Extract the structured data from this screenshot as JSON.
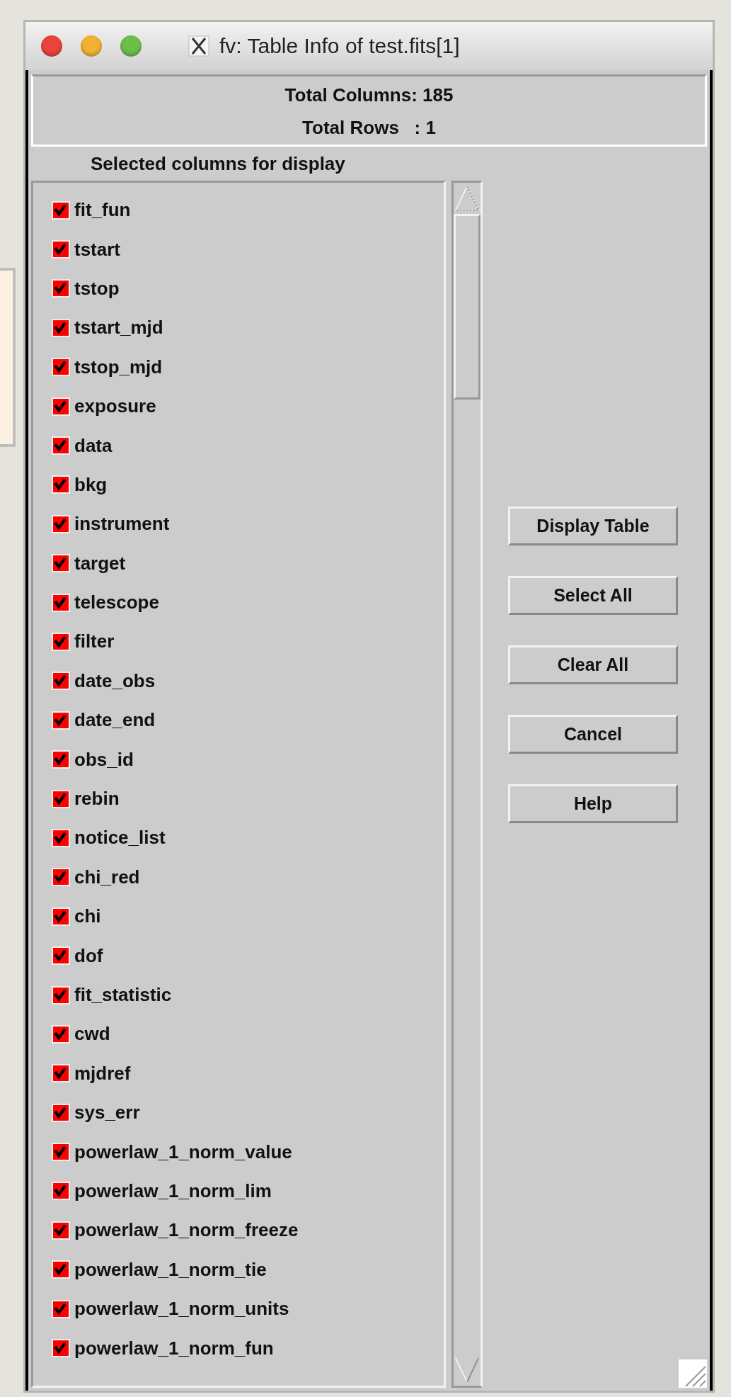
{
  "window": {
    "title": "fv: Table Info of test.fits[1]"
  },
  "info": [
    "Total Columns: 185",
    "Total Rows   : 1"
  ],
  "caption": "Selected columns for display",
  "columns": [
    {
      "label": "fit_fun",
      "checked": true
    },
    {
      "label": "tstart",
      "checked": true
    },
    {
      "label": "tstop",
      "checked": true
    },
    {
      "label": "tstart_mjd",
      "checked": true
    },
    {
      "label": "tstop_mjd",
      "checked": true
    },
    {
      "label": "exposure",
      "checked": true
    },
    {
      "label": "data",
      "checked": true
    },
    {
      "label": "bkg",
      "checked": true
    },
    {
      "label": "instrument",
      "checked": true
    },
    {
      "label": "target",
      "checked": true
    },
    {
      "label": "telescope",
      "checked": true
    },
    {
      "label": "filter",
      "checked": true
    },
    {
      "label": "date_obs",
      "checked": true
    },
    {
      "label": "date_end",
      "checked": true
    },
    {
      "label": "obs_id",
      "checked": true
    },
    {
      "label": "rebin",
      "checked": true
    },
    {
      "label": "notice_list",
      "checked": true
    },
    {
      "label": "chi_red",
      "checked": true
    },
    {
      "label": "chi",
      "checked": true
    },
    {
      "label": "dof",
      "checked": true
    },
    {
      "label": "fit_statistic",
      "checked": true
    },
    {
      "label": "cwd",
      "checked": true
    },
    {
      "label": "mjdref",
      "checked": true
    },
    {
      "label": "sys_err",
      "checked": true
    },
    {
      "label": "powerlaw_1_norm_value",
      "checked": true
    },
    {
      "label": "powerlaw_1_norm_lim",
      "checked": true
    },
    {
      "label": "powerlaw_1_norm_freeze",
      "checked": true
    },
    {
      "label": "powerlaw_1_norm_tie",
      "checked": true
    },
    {
      "label": "powerlaw_1_norm_units",
      "checked": true
    },
    {
      "label": "powerlaw_1_norm_fun",
      "checked": true
    }
  ],
  "buttons": [
    "Display Table",
    "Select All",
    "Clear All",
    "Cancel",
    "Help"
  ]
}
